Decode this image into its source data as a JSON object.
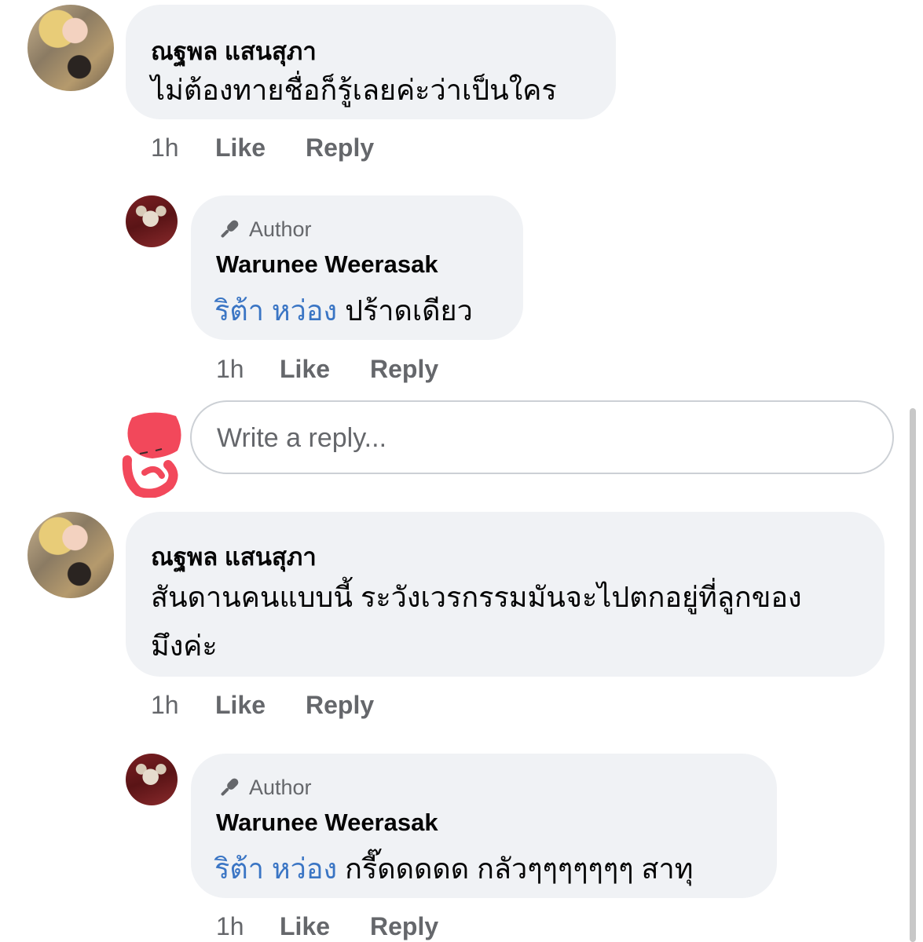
{
  "comments": [
    {
      "author": "ณฐพล แสนสุภา",
      "lines": [
        "ไม่ต้องทายชื่อก็รู้เลยค่ะว่าเป็นใคร"
      ],
      "time": "1h",
      "like_label": "Like",
      "reply_label": "Reply",
      "reply": {
        "badge": "Author",
        "badge_icon": "microphone-icon",
        "author": "Warunee Weerasak",
        "mention": "ริต้า หว่อง",
        "text": "ปร้าดเดียว",
        "time": "1h",
        "like_label": "Like",
        "reply_label": "Reply"
      }
    },
    {
      "author": "ณฐพล แสนสุภา",
      "lines": [
        "สันดานคนแบบนี้  ระวังเวรกรรมมันจะไปตกอยู่ที่ลูกของ",
        "มึงค่ะ"
      ],
      "time": "1h",
      "like_label": "Like",
      "reply_label": "Reply",
      "reply": {
        "badge": "Author",
        "badge_icon": "microphone-icon",
        "author": "Warunee Weerasak",
        "mention": "ริต้า หว่อง",
        "text": "กรี๊ดดดดด กลัวๆๆๆๆๆๆๆ สาทุ",
        "time": "1h",
        "like_label": "Like",
        "reply_label": "Reply"
      }
    }
  ],
  "reply_composer": {
    "placeholder": "Write a reply..."
  },
  "colors": {
    "bubble": "#f0f2f5",
    "mention": "#3a75c4",
    "meta": "#65676b",
    "redaction": "#f2485b"
  }
}
